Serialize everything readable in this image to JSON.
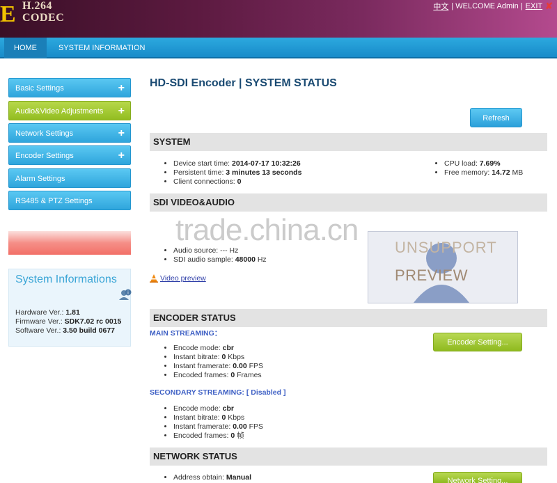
{
  "header": {
    "logo_letter": "E",
    "logo_line1": "H.264",
    "logo_line2": "CODEC",
    "lang_link": "中文",
    "welcome_text": "| WELCOME Admin |",
    "exit_label": "EXIT"
  },
  "nav": {
    "tabs": [
      {
        "label": "HOME"
      },
      {
        "label": "SYSTEM INFORMATION"
      }
    ]
  },
  "sidebar": {
    "items": [
      {
        "label": "Basic Settings",
        "expand": "+"
      },
      {
        "label": "Audio&Video Adjustments",
        "expand": "+"
      },
      {
        "label": "Network Settings",
        "expand": "+"
      },
      {
        "label": "Encoder Settings",
        "expand": "+"
      },
      {
        "label": "Alarm Settings"
      },
      {
        "label": "RS485 & PTZ Settings"
      }
    ],
    "sysinfo": {
      "title": "System Informations",
      "hardware_label": "Hardware Ver.:",
      "hardware_value": "1.81",
      "firmware_label": "Firmware Ver.:",
      "firmware_value": "SDK7.02 rc 0015",
      "software_label": "Software Ver.:",
      "software_value": "3.50 build 0677"
    }
  },
  "main": {
    "title": "HD-SDI Encoder | SYSTEM STATUS",
    "refresh_label": "Refresh",
    "system": {
      "heading": "SYSTEM",
      "start_label": "Device start time:",
      "start_value": "2014-07-17 10:32:26",
      "persistent_label": "Persistent time:",
      "persistent_value": "3 minutes 13 seconds",
      "clients_label": "Client connections:",
      "clients_value": "0",
      "cpu_label": "CPU load:",
      "cpu_value": "7.69%",
      "mem_label": "Free memory:",
      "mem_value": "14.72",
      "mem_unit": "MB"
    },
    "sdi": {
      "heading": "SDI VIDEO&AUDIO",
      "audio_source_label": "Audio source:",
      "audio_source_value": "--- Hz",
      "audio_sample_label": "SDI audio sample:",
      "audio_sample_value": "48000",
      "audio_sample_unit": "Hz",
      "video_preview_label": "Video preview",
      "preview_text_top": "UNSUPPORT",
      "preview_text": "PREVIEW"
    },
    "encoder": {
      "heading": "ENCODER STATUS",
      "main_label": "MAIN STREAMING：",
      "settings_button": "Encoder Setting...",
      "main": {
        "mode_label": "Encode mode:",
        "mode_value": "cbr",
        "bitrate_label": "Instant bitrate:",
        "bitrate_value": "0",
        "bitrate_unit": "Kbps",
        "framerate_label": "Instant framerate:",
        "framerate_value": "0.00",
        "framerate_unit": "FPS",
        "frames_label": "Encoded frames:",
        "frames_value": "0",
        "frames_unit": "Frames"
      },
      "secondary_label": "SECONDARY STREAMING: [ Disabled ]",
      "secondary": {
        "mode_label": "Encode mode:",
        "mode_value": "cbr",
        "bitrate_label": "Instant bitrate:",
        "bitrate_value": "0",
        "bitrate_unit": "Kbps",
        "framerate_label": "Instant framerate:",
        "framerate_value": "0.00",
        "framerate_unit": "FPS",
        "frames_label": "Encoded frames:",
        "frames_value": "0",
        "frames_unit": "帧"
      }
    },
    "network": {
      "heading": "NETWORK STATUS",
      "address_label": "Address obtain:",
      "address_value": "Manual",
      "settings_button": "Network Setting..."
    },
    "watermark": "trade.china.cn"
  }
}
